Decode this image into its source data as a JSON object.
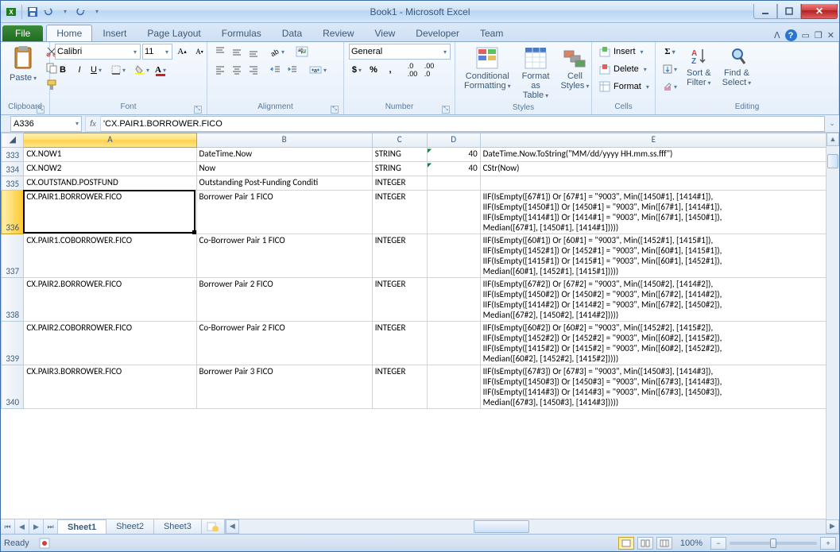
{
  "title": "Book1  -  Microsoft Excel",
  "tabs": {
    "file": "File",
    "home": "Home",
    "insert": "Insert",
    "pagelayout": "Page Layout",
    "formulas": "Formulas",
    "data": "Data",
    "review": "Review",
    "view": "View",
    "developer": "Developer",
    "team": "Team"
  },
  "ribbon": {
    "clipboard": {
      "paste": "Paste",
      "label": "Clipboard"
    },
    "font": {
      "name": "Calibri",
      "size": "11",
      "label": "Font"
    },
    "alignment": {
      "label": "Alignment"
    },
    "number": {
      "format": "General",
      "label": "Number"
    },
    "styles": {
      "cond": "Conditional\nFormatting",
      "fmt": "Format\nas Table",
      "cell": "Cell\nStyles",
      "label": "Styles"
    },
    "cells": {
      "insert": "Insert",
      "delete": "Delete",
      "format": "Format",
      "label": "Cells"
    },
    "editing": {
      "sort": "Sort &\nFilter",
      "find": "Find &\nSelect",
      "label": "Editing"
    }
  },
  "namebox": "A336",
  "formula": "'CX.PAIR1.BORROWER.FICO",
  "columns": [
    "",
    "A",
    "B",
    "C",
    "D",
    "E"
  ],
  "rows": [
    {
      "n": "333",
      "a": "CX.NOW1",
      "b": "DateTime.Now",
      "c": "STRING",
      "d": "40",
      "e": "DateTime.Now.ToString(\"MM/dd/yyyy HH.mm.ss.fff\")"
    },
    {
      "n": "334",
      "a": "CX.NOW2",
      "b": "Now",
      "c": "STRING",
      "d": "40",
      "e": "CStr(Now)"
    },
    {
      "n": "335",
      "a": "CX.OUTSTAND.POSTFUND",
      "b": "Outstanding Post-Funding Conditi",
      "c": "INTEGER",
      "d": "",
      "e": ""
    },
    {
      "n": "336",
      "a": "CX.PAIR1.BORROWER.FICO",
      "b": "Borrower Pair 1 FICO",
      "c": "INTEGER",
      "d": "",
      "e": "IIF(IsEmpty([67#1]) Or [67#1] = \"9003\", Min([1450#1], [1414#1]),\nIIF(IsEmpty([1450#1]) Or [1450#1] = \"9003\", Min([67#1], [1414#1]),\nIIF(IsEmpty([1414#1]) Or [1414#1] = \"9003\", Min([67#1], [1450#1]),\nMedian([67#1], [1450#1], [1414#1]))))"
    },
    {
      "n": "337",
      "a": "CX.PAIR1.COBORROWER.FICO",
      "b": "Co-Borrower Pair 1 FICO",
      "c": "INTEGER",
      "d": "",
      "e": "IIF(IsEmpty([60#1]) Or [60#1] = \"9003\", Min([1452#1], [1415#1]),\nIIF(IsEmpty([1452#1]) Or [1452#1] = \"9003\", Min([60#1], [1415#1]),\nIIF(IsEmpty([1415#1]) Or [1415#1] = \"9003\", Min([60#1], [1452#1]),\nMedian([60#1], [1452#1], [1415#1]))))"
    },
    {
      "n": "338",
      "a": "CX.PAIR2.BORROWER.FICO",
      "b": "Borrower Pair 2 FICO",
      "c": "INTEGER",
      "d": "",
      "e": "IIF(IsEmpty([67#2]) Or [67#2] = \"9003\", Min([1450#2], [1414#2]),\nIIF(IsEmpty([1450#2]) Or [1450#2] = \"9003\", Min([67#2], [1414#2]),\nIIF(IsEmpty([1414#2]) Or [1414#2] = \"9003\", Min([67#2], [1450#2]),\nMedian([67#2], [1450#2], [1414#2]))))"
    },
    {
      "n": "339",
      "a": "CX.PAIR2.COBORROWER.FICO",
      "b": "Co-Borrower Pair 2 FICO",
      "c": "INTEGER",
      "d": "",
      "e": "IIF(IsEmpty([60#2]) Or [60#2] = \"9003\", Min([1452#2], [1415#2]),\nIIF(IsEmpty([1452#2]) Or [1452#2] = \"9003\", Min([60#2], [1415#2]),\nIIF(IsEmpty([1415#2]) Or [1415#2] = \"9003\", Min([60#2], [1452#2]),\nMedian([60#2], [1452#2], [1415#2]))))"
    },
    {
      "n": "340",
      "a": "CX.PAIR3.BORROWER.FICO",
      "b": "Borrower Pair 3 FICO",
      "c": "INTEGER",
      "d": "",
      "e": "IIF(IsEmpty([67#3]) Or [67#3] = \"9003\", Min([1450#3], [1414#3]),\nIIF(IsEmpty([1450#3]) Or [1450#3] = \"9003\", Min([67#3], [1414#3]),\nIIF(IsEmpty([1414#3]) Or [1414#3] = \"9003\", Min([67#3], [1450#3]),\nMedian([67#3], [1450#3], [1414#3]))))"
    }
  ],
  "sheets": {
    "s1": "Sheet1",
    "s2": "Sheet2",
    "s3": "Sheet3"
  },
  "status": {
    "ready": "Ready",
    "zoom": "100%"
  }
}
